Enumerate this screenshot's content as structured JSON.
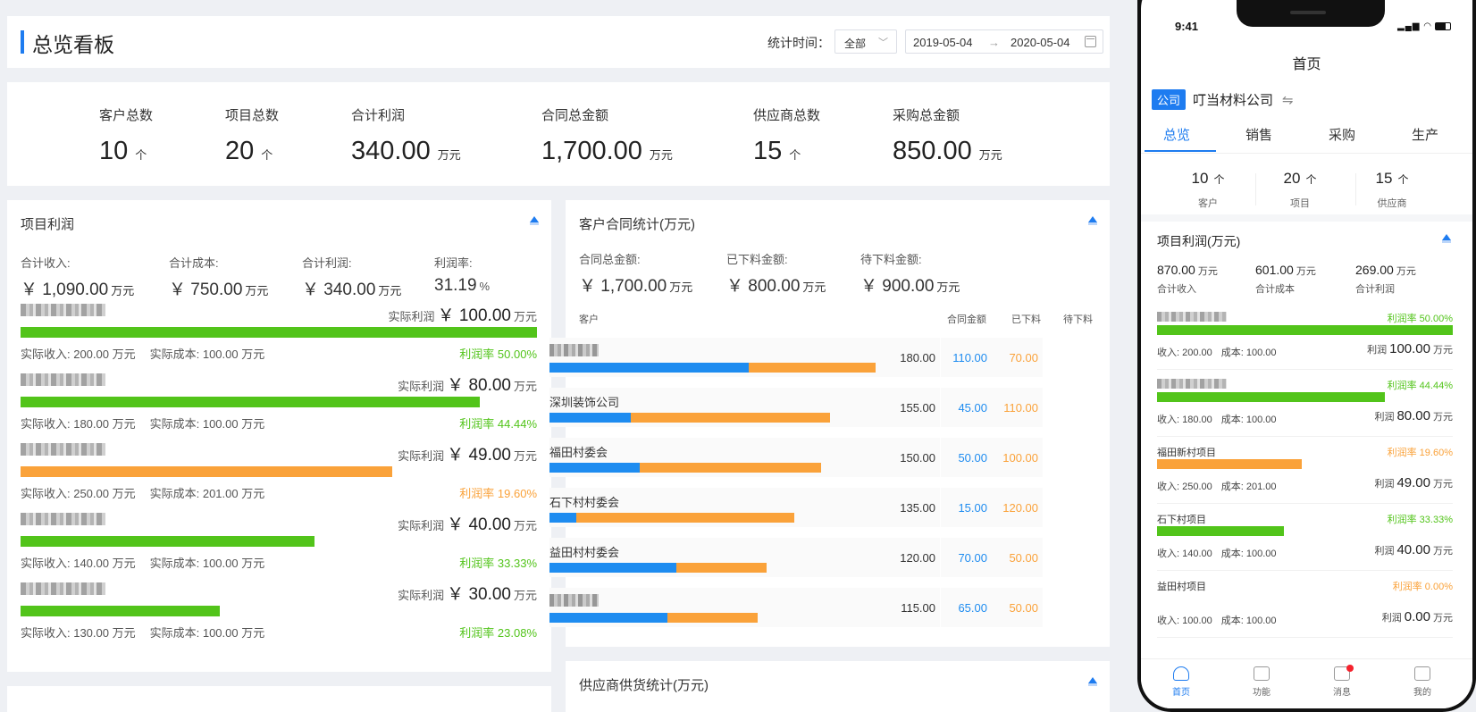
{
  "header": {
    "title": "总览看板",
    "time_label": "统计时间：",
    "scope": "全部",
    "date_from": "2019-05-04",
    "arrow": "→",
    "date_to": "2020-05-04"
  },
  "stats": [
    {
      "label": "客户总数",
      "value": "10",
      "unit": "个"
    },
    {
      "label": "项目总数",
      "value": "20",
      "unit": "个"
    },
    {
      "label": "合计利润",
      "value": "340.00",
      "unit": "万元"
    },
    {
      "label": "合同总金额",
      "value": "1,700.00",
      "unit": "万元"
    },
    {
      "label": "供应商总数",
      "value": "15",
      "unit": "个"
    },
    {
      "label": "采购总金额",
      "value": "850.00",
      "unit": "万元"
    }
  ],
  "project_profit": {
    "title": "项目利润",
    "totals": [
      {
        "label": "合计收入:",
        "value": "￥ 1,090.00",
        "unit": "万元"
      },
      {
        "label": "合计成本:",
        "value": "￥ 750.00",
        "unit": "万元"
      },
      {
        "label": "合计利润:",
        "value": "￥ 340.00",
        "unit": "万元"
      },
      {
        "label": "利润率:",
        "value": "31.19",
        "unit": "%"
      }
    ],
    "profit_label": "实际利润",
    "yen": "￥",
    "unit": "万元",
    "rows": [
      {
        "profit": "100.00",
        "income": "实际收入: 200.00 万元",
        "cost": "实际成本: 100.00 万元",
        "rate": "利润率 50.00%",
        "fill": 1.0,
        "color": "#52c41a"
      },
      {
        "profit": "80.00",
        "income": "实际收入: 180.00 万元",
        "cost": "实际成本: 100.00 万元",
        "rate": "利润率 44.44%",
        "fill": 0.89,
        "color": "#52c41a"
      },
      {
        "profit": "49.00",
        "income": "实际收入: 250.00 万元",
        "cost": "实际成本: 201.00 万元",
        "rate": "利润率 19.60%",
        "fill": 0.72,
        "color": "#faa23a"
      },
      {
        "profit": "40.00",
        "income": "实际收入: 140.00 万元",
        "cost": "实际成本: 100.00 万元",
        "rate": "利润率 33.33%",
        "fill": 0.57,
        "color": "#52c41a"
      },
      {
        "profit": "30.00",
        "income": "实际收入: 130.00 万元",
        "cost": "实际成本: 100.00 万元",
        "rate": "利润率 23.08%",
        "fill": 0.385,
        "color": "#52c41a"
      }
    ]
  },
  "customer_contract": {
    "title": "客户合同统计(万元)",
    "totals": [
      {
        "label": "合同总金额:",
        "value": "￥ 1,700.00",
        "unit": "万元",
        "color": "#333"
      },
      {
        "label": "已下料金额:",
        "value": "￥ 800.00",
        "unit": "万元",
        "color": "#1e8cf0"
      },
      {
        "label": "待下料金额:",
        "value": "￥ 900.00",
        "unit": "万元",
        "color": "#faa23a"
      }
    ],
    "columns": {
      "customer": "客户",
      "amount": "合同金额",
      "done": "已下料",
      "pending": "待下料"
    },
    "rows": [
      {
        "name": "",
        "amount": "180.00",
        "done": "110.00",
        "pending": "70.00",
        "done_v": 110,
        "pending_v": 70
      },
      {
        "name": "深圳装饰公司",
        "amount": "155.00",
        "done": "45.00",
        "pending": "110.00",
        "done_v": 45,
        "pending_v": 110
      },
      {
        "name": "福田村委会",
        "amount": "150.00",
        "done": "50.00",
        "pending": "100.00",
        "done_v": 50,
        "pending_v": 100
      },
      {
        "name": "石下村村委会",
        "amount": "135.00",
        "done": "15.00",
        "pending": "120.00",
        "done_v": 15,
        "pending_v": 120
      },
      {
        "name": "益田村村委会",
        "amount": "120.00",
        "done": "70.00",
        "pending": "50.00",
        "done_v": 70,
        "pending_v": 50
      },
      {
        "name": "",
        "amount": "115.00",
        "done": "65.00",
        "pending": "50.00",
        "done_v": 65,
        "pending_v": 50
      }
    ]
  },
  "supplier": {
    "title": "供应商供货统计(万元)"
  },
  "phone": {
    "time": "9:41",
    "title": "首页",
    "company_tag": "公司",
    "company": "叮当材料公司",
    "switch": "⇋",
    "tabs": [
      "总览",
      "销售",
      "采购",
      "生产"
    ],
    "stats": [
      {
        "value": "10",
        "unit": "个",
        "label": "客户"
      },
      {
        "value": "20",
        "unit": "个",
        "label": "项目"
      },
      {
        "value": "15",
        "unit": "个",
        "label": "供应商"
      }
    ],
    "profit_title": "项目利润(万元)",
    "totals": [
      {
        "value": "870.00",
        "unit": "万元",
        "label": "合计收入"
      },
      {
        "value": "601.00",
        "unit": "万元",
        "label": "合计成本"
      },
      {
        "value": "269.00",
        "unit": "万元",
        "label": "合计利润"
      }
    ],
    "profit_label": "利润",
    "unit": "万元",
    "rows": [
      {
        "name": "",
        "rate": "利润率 50.00%",
        "income": "收入: 200.00",
        "cost": "成本: 100.00",
        "profit": "100.00",
        "fill": 1.0,
        "color": "#52c41a"
      },
      {
        "name": "",
        "rate": "利润率 44.44%",
        "income": "收入: 180.00",
        "cost": "成本: 100.00",
        "profit": "80.00",
        "fill": 0.77,
        "color": "#52c41a"
      },
      {
        "name": "福田新村项目",
        "rate": "利润率 19.60%",
        "income": "收入: 250.00",
        "cost": "成本: 201.00",
        "profit": "49.00",
        "fill": 0.49,
        "color": "#faa23a"
      },
      {
        "name": "石下村项目",
        "rate": "利润率 33.33%",
        "income": "收入: 140.00",
        "cost": "成本: 100.00",
        "profit": "40.00",
        "fill": 0.43,
        "color": "#52c41a"
      },
      {
        "name": "益田村项目",
        "rate": "利润率 0.00%",
        "income": "收入: 100.00",
        "cost": "成本: 100.00",
        "profit": "0.00",
        "fill": 0,
        "color": "#faa23a"
      }
    ],
    "tabbar": [
      "首页",
      "功能",
      "消息",
      "我的"
    ]
  }
}
